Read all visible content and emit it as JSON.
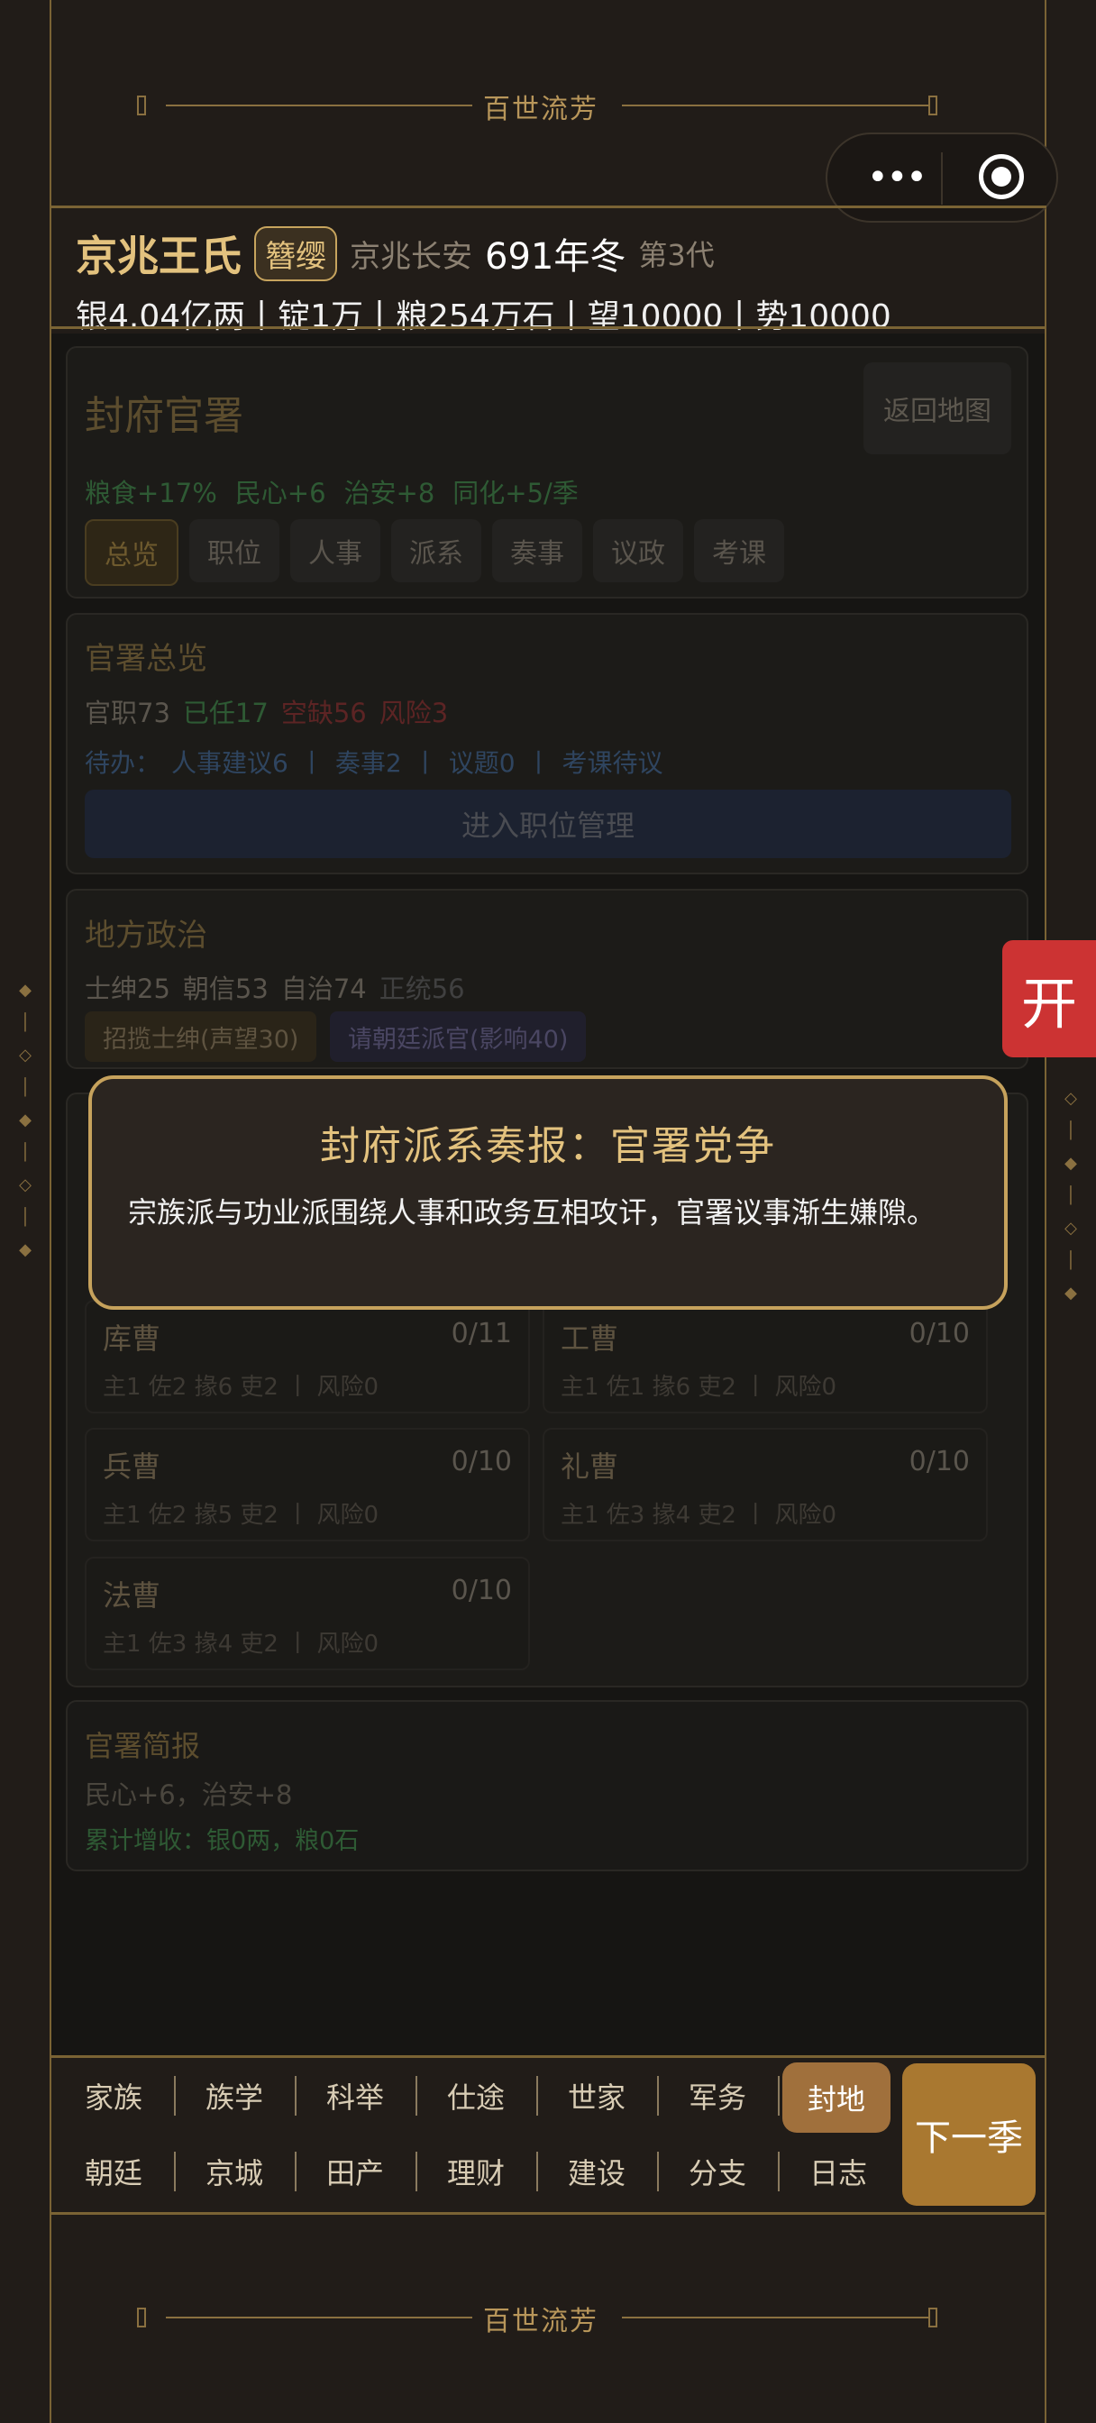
{
  "banner": {
    "title": "百世流芳"
  },
  "status": {
    "clan_name": "京兆王氏",
    "rank_badge": "簪缨",
    "location": "京兆长安",
    "date": "691年冬",
    "generation": "第3代",
    "resources": "银4.04亿两丨锭1万丨粮254万石丨望10000丨势10000"
  },
  "office_card": {
    "title": "封府官署",
    "back_button": "返回地图",
    "bonus_food": "粮食+17%",
    "bonus_morale": "民心+6",
    "bonus_order": "治安+8",
    "bonus_assim": "同化+5/季",
    "tabs": [
      "总览",
      "职位",
      "人事",
      "派系",
      "奏事",
      "议政",
      "考课"
    ]
  },
  "overview": {
    "title": "官署总览",
    "posts": "官职73",
    "filled": "已任17",
    "vacant": "空缺56",
    "risk": "风险3",
    "todo_label": "待办：",
    "todo_personnel": "人事建议6",
    "todo_memorial": "奏事2",
    "todo_topics": "议题0",
    "todo_review": "考课待议",
    "enter_button": "进入职位管理"
  },
  "local_politics": {
    "title": "地方政治",
    "gentry": "士绅25",
    "court_trust": "朝信53",
    "autonomy": "自治74",
    "legitimacy": "正统56",
    "btn_gentry": "招揽士绅(声望30)",
    "btn_court": "请朝廷派官(影响40)"
  },
  "departments": [
    {
      "name": "库曹",
      "count": "0/11",
      "detail": "主1 佐2 掾6 吏2 丨 风险0"
    },
    {
      "name": "工曹",
      "count": "0/10",
      "detail": "主1 佐1 掾6 吏2 丨 风险0"
    },
    {
      "name": "兵曹",
      "count": "0/10",
      "detail": "主1 佐2 掾5 吏2 丨 风险0"
    },
    {
      "name": "礼曹",
      "count": "0/10",
      "detail": "主1 佐3 掾4 吏2 丨 风险0"
    },
    {
      "name": "法曹",
      "count": "0/10",
      "detail": "主1 佐3 掾4 吏2 丨 风险0"
    }
  ],
  "brief": {
    "title": "官署简报",
    "line1": "民心+6，治安+8",
    "line2": "累计增收：银0两，粮0石"
  },
  "modal": {
    "title": "封府派系奏报：官署党争",
    "body": "宗族派与功业派围绕人事和政务互相攻讦，官署议事渐生嫌隙。"
  },
  "side_tab": {
    "label": "开"
  },
  "nav": {
    "row1": [
      "家族",
      "族学",
      "科举",
      "仕途",
      "世家",
      "军务",
      "封地"
    ],
    "row2": [
      "朝廷",
      "京城",
      "田产",
      "理财",
      "建设",
      "分支",
      "日志"
    ],
    "next_season": "下一季"
  },
  "colors": {
    "gold": "#e3c27e",
    "accent": "#a97830",
    "red": "#cc3333",
    "active_tab": "#a0703c"
  }
}
